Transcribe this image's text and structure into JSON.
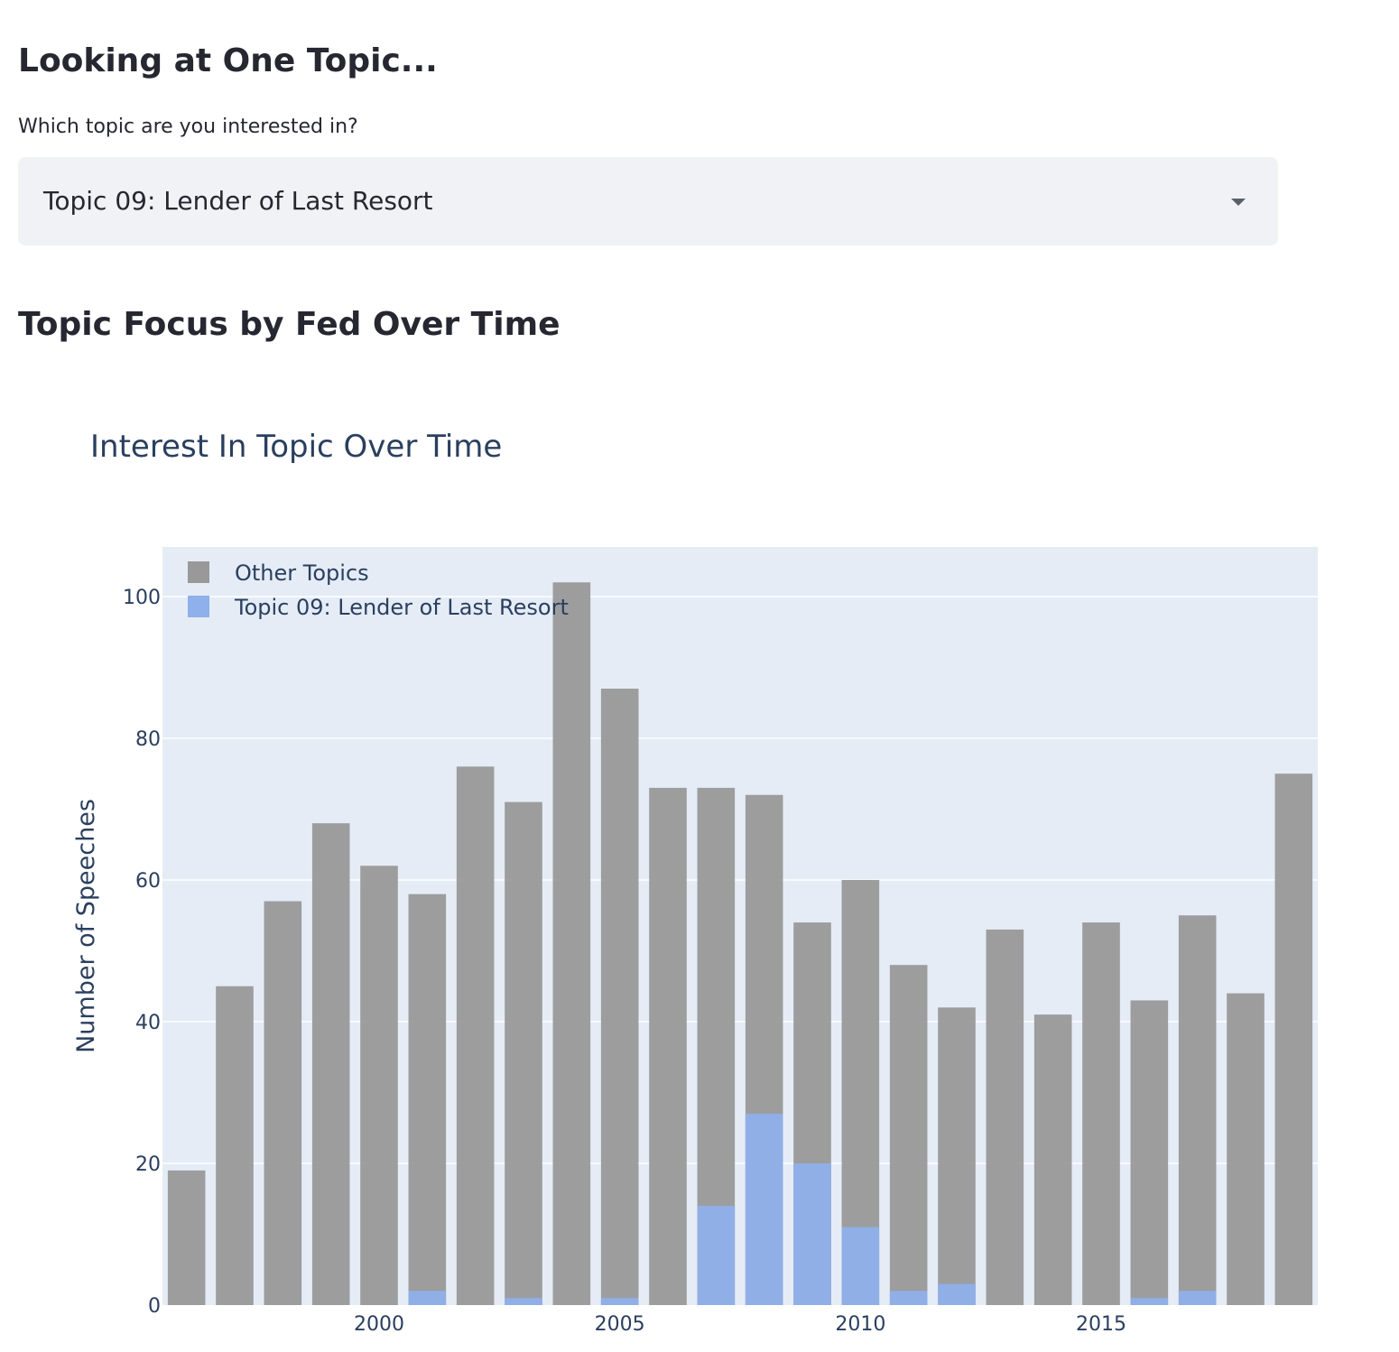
{
  "headers": {
    "looking": "Looking at One Topic...",
    "focus": "Topic Focus by Fed Over Time"
  },
  "select": {
    "label": "Which topic are you interested in?",
    "value": "Topic 09: Lender of Last Resort",
    "icon": "chevron-down-icon"
  },
  "chart_data": {
    "type": "bar",
    "barmode": "overlay",
    "title": "Interest In Topic Over Time",
    "xlabel": "",
    "ylabel": "Number of Speeches",
    "x": [
      1996,
      1997,
      1998,
      1999,
      2000,
      2001,
      2002,
      2003,
      2004,
      2005,
      2006,
      2007,
      2008,
      2009,
      2010,
      2011,
      2012,
      2013,
      2014,
      2015,
      2016,
      2017,
      2018,
      2019
    ],
    "xticks": [
      2000,
      2005,
      2010,
      2015
    ],
    "yticks": [
      0,
      20,
      40,
      60,
      80,
      100
    ],
    "ylim": [
      0,
      107
    ],
    "grid": true,
    "legend_position": "top-left",
    "background": "#e5ecf6",
    "series": [
      {
        "name": "Other Topics",
        "color": "#999999",
        "values": [
          19,
          45,
          57,
          68,
          62,
          58,
          76,
          71,
          102,
          87,
          73,
          73,
          72,
          54,
          60,
          48,
          42,
          53,
          41,
          54,
          43,
          55,
          44,
          75
        ]
      },
      {
        "name": "Topic 09: Lender of Last Resort",
        "color": "#8fb0ea",
        "values": [
          0,
          0,
          0,
          0,
          0,
          2,
          0,
          1,
          0,
          1,
          0,
          14,
          27,
          20,
          11,
          2,
          3,
          0,
          0,
          0,
          1,
          2,
          0,
          0
        ]
      }
    ]
  }
}
